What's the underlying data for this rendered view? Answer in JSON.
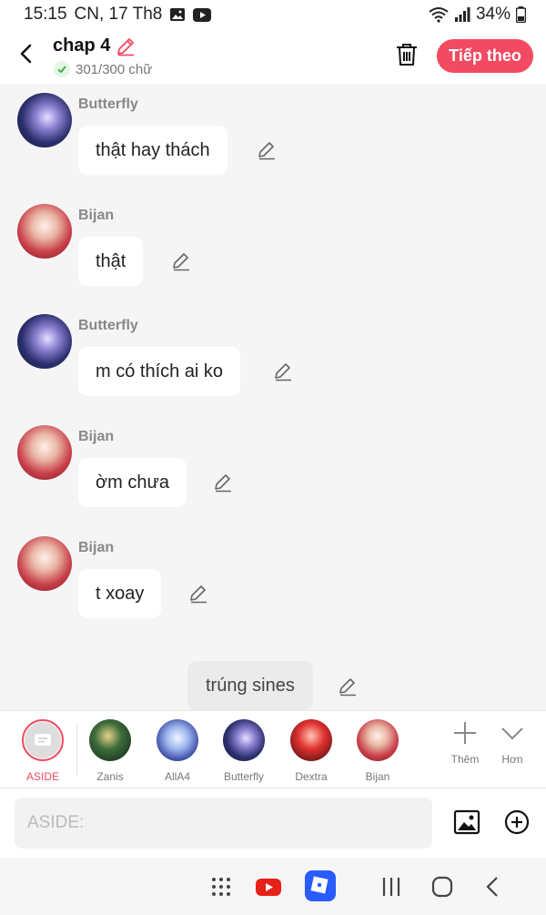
{
  "status_bar": {
    "time": "15:15",
    "date": "CN, 17 Th8",
    "battery": "34%",
    "icons": [
      "image-icon",
      "youtube-icon",
      "wifi-icon",
      "signal-icon",
      "battery-icon"
    ]
  },
  "header": {
    "title": "chap 4",
    "word_count": "301/300 chữ",
    "next_label": "Tiếp theo",
    "accent_color": "#f24a62"
  },
  "messages": [
    {
      "sender": "Butterfly",
      "text": "thật hay thách",
      "avatar": "butterfly"
    },
    {
      "sender": "Bijan",
      "text": "thật",
      "avatar": "bijan"
    },
    {
      "sender": "Butterfly",
      "text": "m có thích ai ko",
      "avatar": "butterfly"
    },
    {
      "sender": "Bijan",
      "text": "ờm chưa",
      "avatar": "bijan"
    },
    {
      "sender": "Bijan",
      "text": "t xoay",
      "avatar": "bijan"
    }
  ],
  "aside_message": {
    "text": "trúng sines"
  },
  "characters": {
    "aside_label": "ASIDE",
    "items": [
      {
        "name": "Zanis"
      },
      {
        "name": "AllA4"
      },
      {
        "name": "Butterfly"
      },
      {
        "name": "Dextra"
      },
      {
        "name": "Bijan"
      }
    ],
    "add_label": "Thêm",
    "more_label": "Hơn"
  },
  "input": {
    "placeholder": "ASIDE:"
  }
}
